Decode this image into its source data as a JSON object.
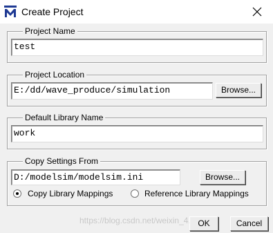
{
  "window": {
    "title": "Create Project",
    "icon": "modelsim-logo-icon",
    "close_icon": "close-icon"
  },
  "project_name": {
    "label": "Project Name",
    "value": "test"
  },
  "project_location": {
    "label": "Project Location",
    "value": "E:/dd/wave_produce/simulation",
    "browse_label": "Browse..."
  },
  "default_library": {
    "label": "Default Library Name",
    "value": "work"
  },
  "copy_settings": {
    "label": "Copy Settings From",
    "value": "D:/modelsim/modelsim.ini",
    "browse_label": "Browse...",
    "options": [
      {
        "label": "Copy Library Mappings",
        "selected": true
      },
      {
        "label": "Reference Library Mappings",
        "selected": false
      }
    ]
  },
  "footer": {
    "ok_label": "OK",
    "cancel_label": "Cancel",
    "watermark": "https://blog.csdn.net/weixin_4..."
  }
}
